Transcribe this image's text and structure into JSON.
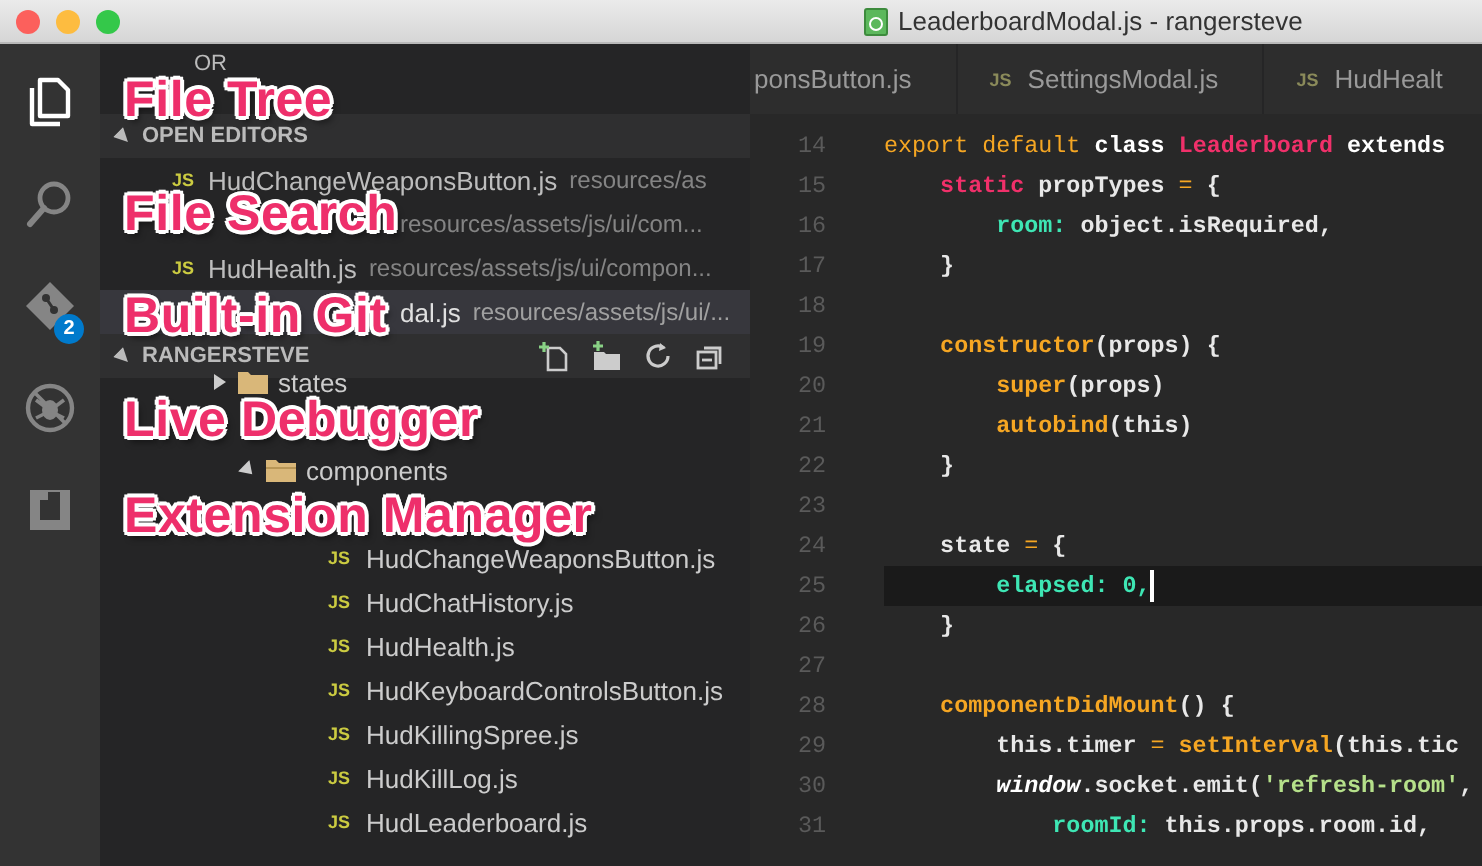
{
  "window": {
    "title": "LeaderboardModal.js - rangersteve"
  },
  "activity_bar": [
    {
      "kind": "files",
      "selected": true
    },
    {
      "kind": "search",
      "selected": false
    },
    {
      "kind": "git",
      "selected": false,
      "badge": "2"
    },
    {
      "kind": "debug",
      "selected": false
    },
    {
      "kind": "extensions",
      "selected": false
    }
  ],
  "sidebar": {
    "header": "OR",
    "open_editors": {
      "title": "OPEN EDITORS",
      "expanded": true,
      "items": [
        {
          "icon": "JS",
          "name": "HudChangeWeaponsButton.js",
          "path": "resources/as",
          "selected": false
        },
        {
          "path": "resources/assets/js/ui/com...",
          "selected": false
        },
        {
          "icon": "JS",
          "name": "HudHealth.js",
          "path": "resources/assets/js/ui/compon...",
          "selected": false
        },
        {
          "name": "dal.js",
          "path": "resources/assets/js/ui/...",
          "selected": true
        }
      ]
    },
    "project": {
      "title": "RANGERSTEVE",
      "expanded": true,
      "tree": [
        {
          "kind": "folder",
          "name": "states",
          "expanded": false
        },
        {
          "kind": "folder",
          "children": [
            {
              "kind": "folder",
              "name": "components",
              "expanded": true,
              "children": [
                {
                  "kind": "blank"
                },
                {
                  "kind": "file",
                  "icon": "JS",
                  "name": "HudChangeWeaponsButton.js"
                },
                {
                  "kind": "file",
                  "icon": "JS",
                  "name": "HudChatHistory.js"
                },
                {
                  "kind": "file",
                  "icon": "JS",
                  "name": "HudHealth.js"
                },
                {
                  "kind": "file",
                  "icon": "JS",
                  "name": "HudKeyboardControlsButton.js"
                },
                {
                  "kind": "file",
                  "icon": "JS",
                  "name": "HudKillingSpree.js"
                },
                {
                  "kind": "file",
                  "icon": "JS",
                  "name": "HudKillLog.js"
                },
                {
                  "kind": "file",
                  "icon": "JS",
                  "name": "HudLeaderboard.js"
                }
              ]
            }
          ]
        }
      ]
    }
  },
  "tabs": [
    {
      "label": "ponsButton.js",
      "selected": false
    },
    {
      "icon": "JS",
      "label": "SettingsModal.js",
      "selected": false
    },
    {
      "icon": "JS",
      "label": "HudHealt",
      "selected": false
    }
  ],
  "code": [
    {
      "n": "14",
      "current": false,
      "tokens": [
        {
          "text": "export default ",
          "kind": "keyword"
        },
        {
          "text": "class ",
          "kind": "storage"
        },
        {
          "text": "Leaderboard ",
          "kind": "entity"
        },
        {
          "text": "extends",
          "kind": "storage"
        }
      ]
    },
    {
      "n": "15",
      "current": false,
      "tokens": [
        {
          "text": "    static ",
          "kind": "entity"
        },
        {
          "text": "propTypes ",
          "kind": "plain"
        },
        {
          "text": "= ",
          "kind": "keyword"
        },
        {
          "text": "{",
          "kind": "plain"
        }
      ]
    },
    {
      "n": "16",
      "current": false,
      "tokens": [
        {
          "text": "        room: ",
          "kind": "property"
        },
        {
          "text": "object.isRequired,",
          "kind": "plain"
        }
      ]
    },
    {
      "n": "17",
      "current": false,
      "tokens": [
        {
          "text": "    }",
          "kind": "plain"
        }
      ]
    },
    {
      "n": "18",
      "current": false
    },
    {
      "n": "19",
      "current": false,
      "tokens": [
        {
          "text": "    constructor",
          "kind": "function"
        },
        {
          "text": "(props) {",
          "kind": "plain"
        }
      ]
    },
    {
      "n": "20",
      "current": false,
      "tokens": [
        {
          "text": "        super",
          "kind": "function"
        },
        {
          "text": "(props)",
          "kind": "plain"
        }
      ]
    },
    {
      "n": "21",
      "current": false,
      "tokens": [
        {
          "text": "        autobind",
          "kind": "function"
        },
        {
          "text": "(this)",
          "kind": "plain"
        }
      ]
    },
    {
      "n": "22",
      "current": false,
      "tokens": [
        {
          "text": "    }",
          "kind": "plain"
        }
      ]
    },
    {
      "n": "23",
      "current": false
    },
    {
      "n": "24",
      "current": false,
      "tokens": [
        {
          "text": "    state ",
          "kind": "plain"
        },
        {
          "text": "= ",
          "kind": "keyword"
        },
        {
          "text": "{",
          "kind": "plain"
        }
      ]
    },
    {
      "n": "25",
      "current": true,
      "tokens": [
        {
          "text": "        elapsed: 0,",
          "kind": "property"
        }
      ]
    },
    {
      "n": "26",
      "current": false,
      "tokens": [
        {
          "text": "    }",
          "kind": "plain"
        }
      ]
    },
    {
      "n": "27",
      "current": false
    },
    {
      "n": "28",
      "current": false,
      "tokens": [
        {
          "text": "    componentDidMount",
          "kind": "function"
        },
        {
          "text": "() {",
          "kind": "plain"
        }
      ]
    },
    {
      "n": "29",
      "current": false,
      "tokens": [
        {
          "text": "        this.timer ",
          "kind": "plain"
        },
        {
          "text": "= ",
          "kind": "keyword"
        },
        {
          "text": "setInterval",
          "kind": "function"
        },
        {
          "text": "(this.tic",
          "kind": "plain"
        }
      ]
    },
    {
      "n": "30",
      "current": false,
      "tokens": [
        {
          "text": "        window",
          "kind": "global"
        },
        {
          "text": ".socket.emit(",
          "kind": "plain"
        },
        {
          "text": "'refresh-room'",
          "kind": "string"
        },
        {
          "text": ",",
          "kind": "plain"
        }
      ]
    },
    {
      "n": "31",
      "current": false,
      "tokens": [
        {
          "text": "            roomId: ",
          "kind": "property"
        },
        {
          "text": "this.props.room.id,",
          "kind": "plain"
        }
      ]
    }
  ],
  "annotations": [
    "File Tree",
    "File Search",
    "Built-in Git",
    "Live Debugger",
    "Extension Manager"
  ]
}
